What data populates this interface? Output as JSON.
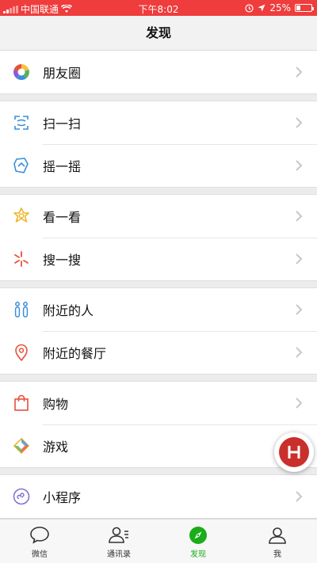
{
  "status_bar": {
    "carrier": "中国联通",
    "time": "下午8:02",
    "battery": "25%",
    "battery_level": 0.25
  },
  "nav": {
    "title": "发现"
  },
  "groups": [
    {
      "items": [
        {
          "label": "朋友圈",
          "icon": "moments-icon"
        }
      ]
    },
    {
      "items": [
        {
          "label": "扫一扫",
          "icon": "scan-icon"
        },
        {
          "label": "摇一摇",
          "icon": "shake-icon"
        }
      ]
    },
    {
      "items": [
        {
          "label": "看一看",
          "icon": "top-stories-icon"
        },
        {
          "label": "搜一搜",
          "icon": "search-icon"
        }
      ]
    },
    {
      "items": [
        {
          "label": "附近的人",
          "icon": "people-nearby-icon"
        },
        {
          "label": "附近的餐厅",
          "icon": "location-pin-icon"
        }
      ]
    },
    {
      "items": [
        {
          "label": "购物",
          "icon": "shopping-bag-icon"
        },
        {
          "label": "游戏",
          "icon": "game-icon"
        }
      ]
    },
    {
      "items": [
        {
          "label": "小程序",
          "icon": "mini-program-icon"
        }
      ]
    }
  ],
  "tabbar": {
    "items": [
      {
        "label": "微信",
        "icon": "chat-bubble-icon"
      },
      {
        "label": "通讯录",
        "icon": "contacts-icon"
      },
      {
        "label": "发现",
        "icon": "compass-icon",
        "active": true
      },
      {
        "label": "我",
        "icon": "profile-icon"
      }
    ]
  },
  "colors": {
    "status_bar": "#ef3c3c",
    "accent": "#1aad19",
    "float_badge": "#c9302c"
  }
}
